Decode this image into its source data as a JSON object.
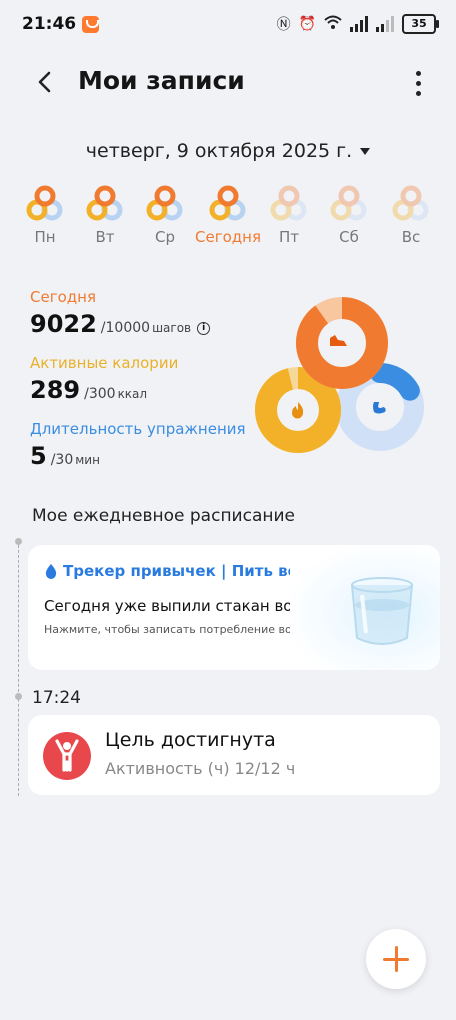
{
  "status": {
    "time": "21:46",
    "battery": "35"
  },
  "header": {
    "title": "Мои записи"
  },
  "date": {
    "label": "четверг, 9 октября 2025 г."
  },
  "week": [
    {
      "label": "Пн",
      "state": "past"
    },
    {
      "label": "Вт",
      "state": "past"
    },
    {
      "label": "Ср",
      "state": "past"
    },
    {
      "label": "Сегодня",
      "state": "today"
    },
    {
      "label": "Пт",
      "state": "future"
    },
    {
      "label": "Сб",
      "state": "future"
    },
    {
      "label": "Вс",
      "state": "future"
    }
  ],
  "stats": {
    "steps": {
      "label": "Сегодня",
      "value": "9022",
      "goal": "/10000",
      "unit": "шагов",
      "color": "#f07a30",
      "progress": 0.9
    },
    "calories": {
      "label": "Активные калории",
      "value": "289",
      "goal": "/300",
      "unit": "ккал",
      "color": "#f2b129",
      "progress": 0.96
    },
    "exercise": {
      "label": "Длительность упражнения",
      "value": "5",
      "goal": "/30",
      "unit": "мин",
      "color": "#3a8de0",
      "progress": 0.17
    }
  },
  "schedule": {
    "title": "Мое ежедневное расписание",
    "water": {
      "header": "Трекер привычек | Пить воду",
      "question": "Сегодня уже выпили стакан воды?",
      "hint": "Нажмите, чтобы записать потребление воды."
    },
    "entry": {
      "time": "17:24",
      "title": "Цель достигнута",
      "subtitle": "Активность (ч) 12/12 ч"
    }
  },
  "icons": {
    "back": "back-arrow-icon",
    "more": "more-vertical-icon",
    "water": "water-drop-icon",
    "shoe": "shoe-icon",
    "flame": "flame-icon",
    "muscle": "muscle-icon",
    "person": "person-raising-arms-icon",
    "add": "plus-icon"
  }
}
